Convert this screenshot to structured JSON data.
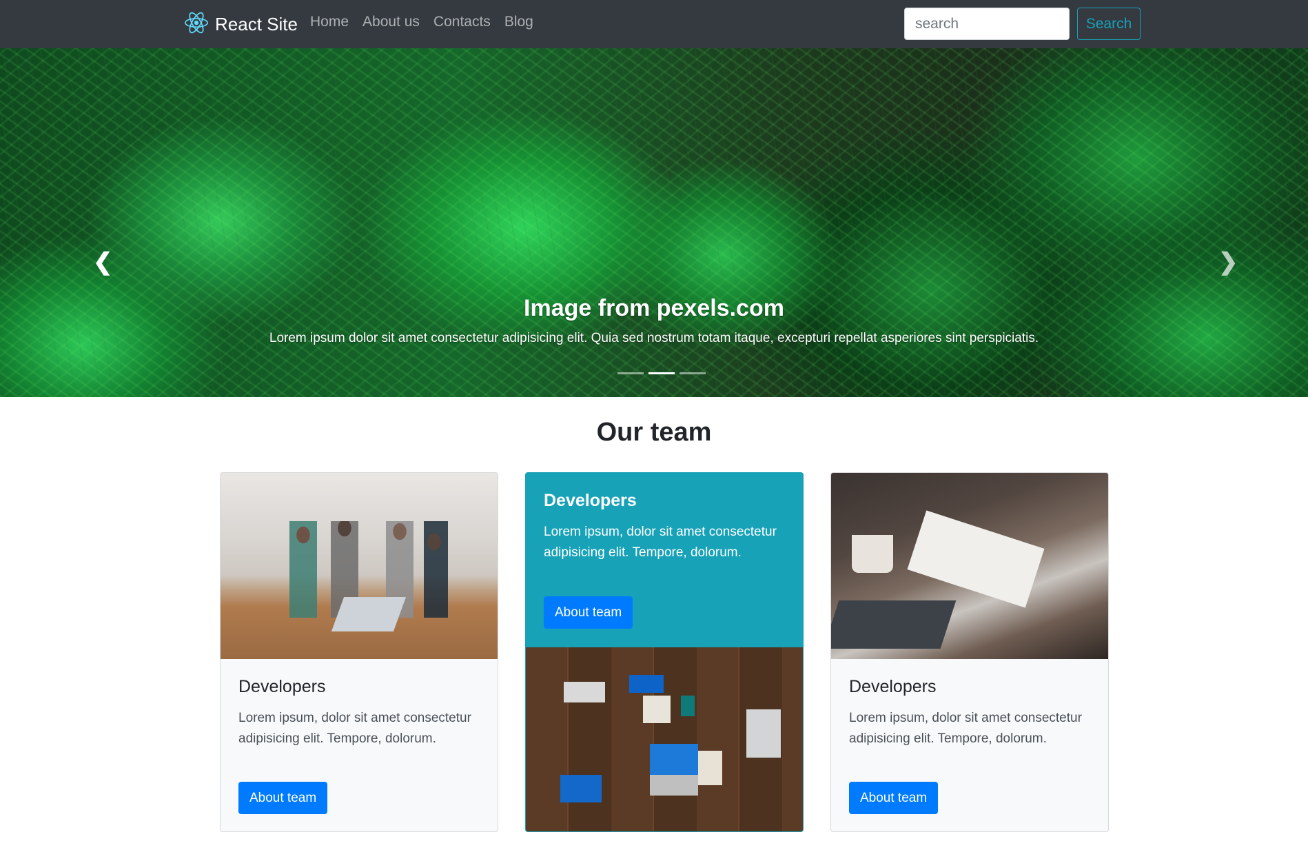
{
  "navbar": {
    "brand": "React Site",
    "links": [
      "Home",
      "About us",
      "Contacts",
      "Blog"
    ],
    "search_placeholder": "search",
    "search_button": "Search"
  },
  "carousel": {
    "title": "Image from pexels.com",
    "text": "Lorem ipsum dolor sit amet consectetur adipisicing elit. Quia sed nostrum totam itaque, excepturi repellat asperiores sint perspiciatis.",
    "prev_icon": "chevron-left-icon",
    "next_icon": "chevron-right-icon",
    "slide_count": 3,
    "active_slide": 2
  },
  "team": {
    "heading": "Our team",
    "cards": [
      {
        "title": "Developers",
        "text": "Lorem ipsum, dolor sit amet consectetur adipisicing elit. Tempore, dolorum.",
        "button": "About team"
      },
      {
        "title": "Developers",
        "text": "Lorem ipsum, dolor sit amet consectetur adipisicing elit. Tempore, dolorum.",
        "button": "About team"
      },
      {
        "title": "Developers",
        "text": "Lorem ipsum, dolor sit amet consectetur adipisicing elit. Tempore, dolorum.",
        "button": "About team"
      }
    ]
  },
  "colors": {
    "navbar_bg": "#343a40",
    "accent_info": "#17a2b8",
    "primary": "#007bff"
  }
}
